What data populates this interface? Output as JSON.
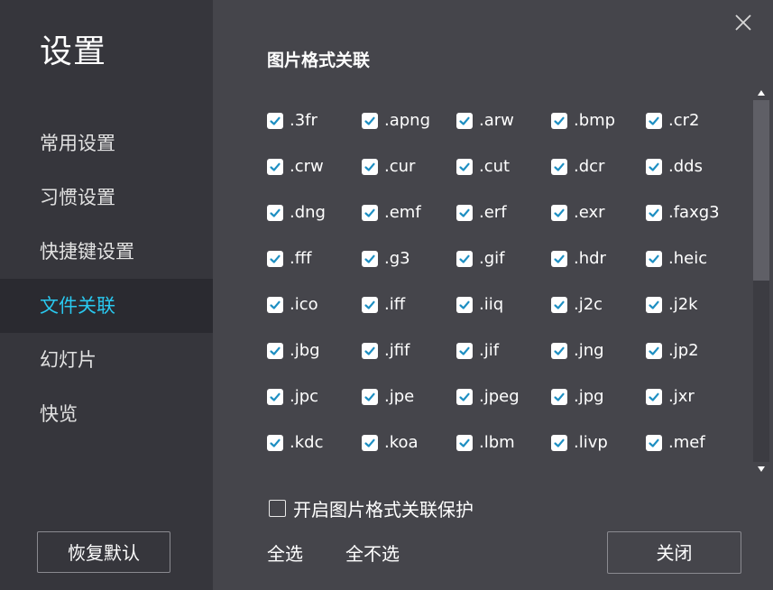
{
  "sidebar": {
    "title": "设置",
    "items": [
      {
        "label": "常用设置",
        "active": false
      },
      {
        "label": "习惯设置",
        "active": false
      },
      {
        "label": "快捷键设置",
        "active": false
      },
      {
        "label": "文件关联",
        "active": true
      },
      {
        "label": "幻灯片",
        "active": false
      },
      {
        "label": "快览",
        "active": false
      }
    ],
    "reset_label": "恢复默认"
  },
  "main": {
    "section_title": "图片格式关联",
    "formats": [
      [
        ".3fr",
        ".apng",
        ".arw",
        ".bmp",
        ".cr2"
      ],
      [
        ".crw",
        ".cur",
        ".cut",
        ".dcr",
        ".dds"
      ],
      [
        ".dng",
        ".emf",
        ".erf",
        ".exr",
        ".faxg3"
      ],
      [
        ".fff",
        ".g3",
        ".gif",
        ".hdr",
        ".heic"
      ],
      [
        ".ico",
        ".iff",
        ".iiq",
        ".j2c",
        ".j2k"
      ],
      [
        ".jbg",
        ".jfif",
        ".jif",
        ".jng",
        ".jp2"
      ],
      [
        ".jpc",
        ".jpe",
        ".jpeg",
        ".jpg",
        ".jxr"
      ],
      [
        ".kdc",
        ".koa",
        ".lbm",
        ".livp",
        ".mef"
      ]
    ],
    "all_checked": true,
    "protect_label": "开启图片格式关联保护",
    "protect_checked": false,
    "select_all_label": "全选",
    "select_none_label": "全不选",
    "close_label": "关闭"
  },
  "colors": {
    "accent": "#29c8ef",
    "checkbox_check": "#1e8fc2",
    "sidebar_bg": "#36363c",
    "main_bg": "#45454b"
  }
}
